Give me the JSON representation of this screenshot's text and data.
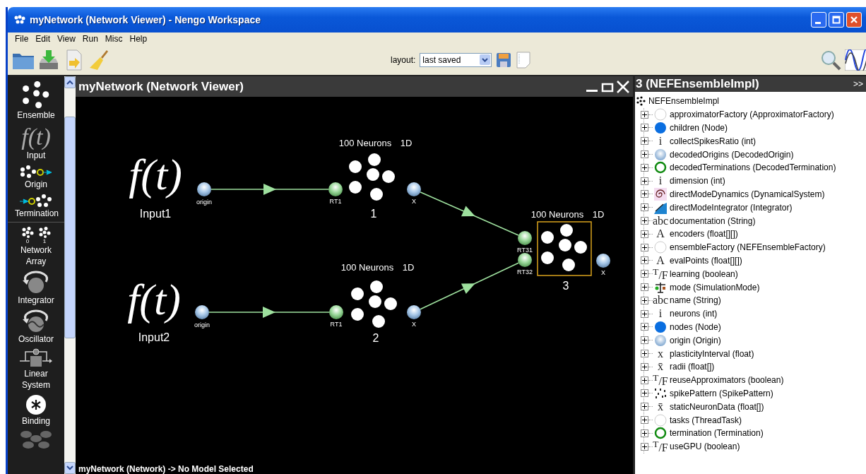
{
  "window": {
    "title": "myNetwork (Network Viewer) - Nengo Workspace"
  },
  "menu": [
    "File",
    "Edit",
    "View",
    "Run",
    "Misc",
    "Help"
  ],
  "toolbar": {
    "layout_label": "layout:",
    "layout_value": "last saved"
  },
  "palette": [
    {
      "kind": "ensemble",
      "label": "Ensemble"
    },
    {
      "kind": "input",
      "glyph": "f(t)",
      "label": "Input"
    },
    {
      "kind": "origin",
      "label": "Origin"
    },
    {
      "kind": "termination",
      "label": "Termination"
    },
    {
      "kind": "network-array",
      "label": "Network Array",
      "indices": [
        "0",
        "1"
      ]
    },
    {
      "kind": "integrator",
      "label": "Integrator"
    },
    {
      "kind": "oscillator",
      "label": "Oscillator"
    },
    {
      "kind": "linear-system",
      "label": "Linear System"
    },
    {
      "kind": "binding",
      "label": "Binding"
    },
    {
      "kind": "basal-ganglia"
    }
  ],
  "viewer": {
    "title": "myNetwork (Network Viewer)",
    "status": "myNetwork (Network) -> No Model Selected",
    "inputs": [
      {
        "symbol": "f(t)",
        "name": "Input1",
        "origin": "origin"
      },
      {
        "symbol": "f(t)",
        "name": "Input2",
        "origin": "origin"
      }
    ],
    "ensembles": [
      {
        "neurons": "100 Neurons",
        "dims": "1D",
        "name": "1",
        "terminations": [
          "RT1"
        ],
        "origin": "X",
        "selected": false
      },
      {
        "neurons": "100 Neurons",
        "dims": "1D",
        "name": "2",
        "terminations": [
          "RT1"
        ],
        "origin": "X",
        "selected": false
      },
      {
        "neurons": "100 Neurons",
        "dims": "1D",
        "name": "3",
        "terminations": [
          "RT31",
          "RT32"
        ],
        "origin": "X",
        "selected": true
      }
    ]
  },
  "inspector": {
    "title": "3 (NEFEnsembleImpl)",
    "collapse": ">>",
    "root": "NEFEnsembleImpl",
    "properties": [
      {
        "kind": "empty-circle",
        "label": "approximatorFactory (ApproximatorFactory)",
        "expanded": false
      },
      {
        "kind": "blue-dot",
        "label": "children (Node)",
        "expanded": false
      },
      {
        "kind": "glyph",
        "glyph": "i",
        "label": "collectSpikesRatio (int)",
        "expanded": false
      },
      {
        "kind": "ball",
        "label": "decodedOrigins (DecodedOrigin)",
        "expanded": false
      },
      {
        "kind": "green-ring",
        "label": "decodedTerminations (DecodedTermination)",
        "expanded": false
      },
      {
        "kind": "glyph",
        "glyph": "i",
        "label": "dimension (int)",
        "expanded": false
      },
      {
        "kind": "spiral",
        "label": "directModeDynamics (DynamicalSystem)",
        "expanded": false
      },
      {
        "kind": "ramp",
        "label": "directModeIntegrator (Integrator)",
        "expanded": false
      },
      {
        "kind": "glyph",
        "glyph": "abc",
        "label": "documentation (String)",
        "expanded": false
      },
      {
        "kind": "glyph",
        "glyph": "A",
        "label": "encoders (float[][])",
        "expanded": false
      },
      {
        "kind": "empty-circle",
        "label": "ensembleFactory (NEFEnsembleFactory)",
        "expanded": false
      },
      {
        "kind": "glyph",
        "glyph": "A",
        "label": "evalPoints (float[][])",
        "expanded": false
      },
      {
        "kind": "glyph",
        "glyph": "$^{T}$/F",
        "label": "learning (boolean)",
        "expanded": false
      },
      {
        "kind": "mode",
        "label": "mode (SimulationMode)",
        "expanded": false
      },
      {
        "kind": "glyph",
        "glyph": "abc",
        "label": "name (String)",
        "expanded": false
      },
      {
        "kind": "glyph",
        "glyph": "i",
        "label": "neurons (int)",
        "expanded": false
      },
      {
        "kind": "blue-dot",
        "label": "nodes (Node)",
        "expanded": false
      },
      {
        "kind": "ball",
        "label": "origin (Origin)",
        "expanded": false
      },
      {
        "kind": "glyph",
        "glyph": "x",
        "label": "plasticityInterval (float)",
        "expanded": false
      },
      {
        "kind": "glyph",
        "glyph": "x̄",
        "label": "radii (float[])",
        "expanded": false
      },
      {
        "kind": "glyph",
        "glyph": "$^{T}$/F",
        "label": "reuseApproximators (boolean)",
        "expanded": false
      },
      {
        "kind": "spikes",
        "label": "spikePattern (SpikePattern)",
        "expanded": false
      },
      {
        "kind": "glyph",
        "glyph": "x̄",
        "label": "staticNeuronData (float[])",
        "expanded": false
      },
      {
        "kind": "empty-circle",
        "label": "tasks (ThreadTask)",
        "expanded": false
      },
      {
        "kind": "green-ring",
        "label": "termination (Termination)",
        "expanded": false
      },
      {
        "kind": "glyph",
        "glyph": "$^{T}$/F",
        "label": "useGPU (boolean)",
        "expanded": false
      }
    ]
  }
}
